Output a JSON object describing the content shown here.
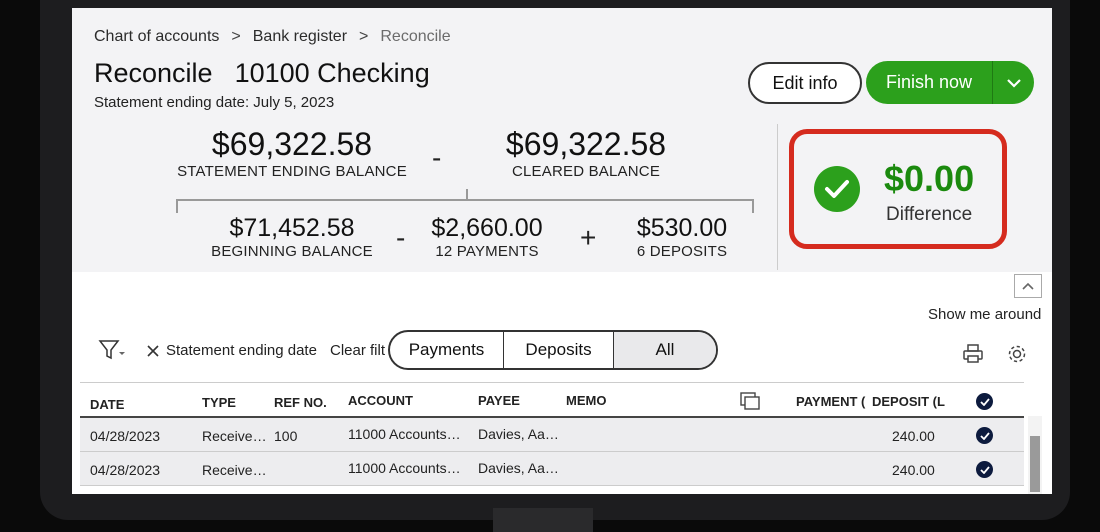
{
  "breadcrumb": {
    "items": [
      "Chart of accounts",
      "Bank register",
      "Reconcile"
    ]
  },
  "header": {
    "title": "Reconcile",
    "account": "10100 Checking",
    "statement_date": "Statement ending date: July 5, 2023"
  },
  "actions": {
    "edit_label": "Edit info",
    "finish_label": "Finish now"
  },
  "summary": {
    "statement_ending_balance": {
      "amount": "$69,322.58",
      "label": "STATEMENT ENDING BALANCE"
    },
    "op_minus": "-",
    "cleared_balance": {
      "amount": "$69,322.58",
      "label": "CLEARED BALANCE"
    },
    "beginning_balance": {
      "amount": "$71,452.58",
      "label": "BEGINNING BALANCE"
    },
    "op_minus2": "-",
    "payments": {
      "amount": "$2,660.00",
      "label": "12 PAYMENTS"
    },
    "op_plus": "+",
    "deposits": {
      "amount": "$530.00",
      "label": "6 DEPOSITS"
    }
  },
  "difference": {
    "amount": "$0.00",
    "label": "Difference",
    "color": "#1b8a0e",
    "highlight_color": "#d52b1e"
  },
  "help": {
    "show_me_around": "Show me around"
  },
  "filters": {
    "chip_label": "Statement ending date",
    "clear_label": "Clear filt",
    "segments": [
      "Payments",
      "Deposits",
      "All"
    ],
    "selected": "All"
  },
  "table": {
    "headers": {
      "date": "DATE",
      "type": "TYPE",
      "ref": "REF NO.",
      "account": "ACCOUNT",
      "payee": "PAYEE",
      "memo": "MEMO",
      "payment": "PAYMENT (",
      "deposit": "DEPOSIT (L"
    },
    "rows": [
      {
        "date": "04/28/2023",
        "type": "Receive…",
        "ref": "100",
        "account": "11000 Accounts…",
        "payee": "Davies, Aa…",
        "memo": "",
        "payment": "",
        "deposit": "240.00",
        "cleared": true
      },
      {
        "date": "04/28/2023",
        "type": "Receive…",
        "ref": "",
        "account": "11000 Accounts…",
        "payee": "Davies, Aa…",
        "memo": "",
        "payment": "",
        "deposit": "240.00",
        "cleared": true
      }
    ]
  },
  "colors": {
    "accent_green": "#2ca01c",
    "check_navy": "#0d1b3e"
  }
}
